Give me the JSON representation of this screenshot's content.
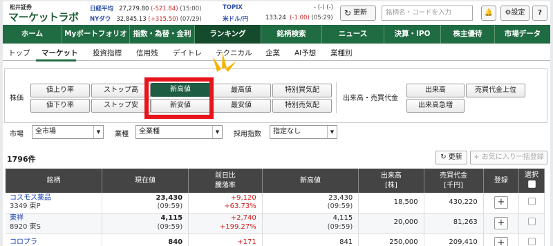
{
  "brand": {
    "small": "松井証券",
    "main": "マーケットラボ"
  },
  "tickers": [
    {
      "name": "日経平均",
      "value": "27,279.80",
      "change": "(-521.84)",
      "time": "(15:00)"
    },
    {
      "name": "NYダウ",
      "value": "32,845.13",
      "change": "(+315.50)",
      "time": "(07/29)"
    },
    {
      "name": "TOPIX",
      "value": "-",
      "change": "(-)",
      "time": "(-)"
    },
    {
      "name": "米ドル/円",
      "value": "133.24",
      "change": "(-1.00)",
      "time": "(05:29)"
    }
  ],
  "header": {
    "refresh": "更新",
    "search_placeholder": "銘柄名・コードを入力",
    "settings": "設定",
    "help": "?"
  },
  "main_nav": [
    "ホーム",
    "Myポートフォリオ",
    "指数・為替・金利",
    "ランキング",
    "銘柄検索",
    "ニュース",
    "決算・IPO",
    "株主優待",
    "市場データ"
  ],
  "sub_tabs": [
    "トップ",
    "マーケット",
    "投資指標",
    "信用残",
    "デイトレ",
    "テクニカル",
    "企業",
    "AI予想",
    "業種別"
  ],
  "filters": {
    "stock_label": "株価",
    "buttons_row1": [
      "値上り率",
      "ストップ高",
      "新高値",
      "最高値",
      "特別買気配"
    ],
    "buttons_row2": [
      "値下り率",
      "ストップ安",
      "新安値",
      "最安値",
      "特別売気配"
    ],
    "volume_label": "出来高・売買代金",
    "vol_row1": [
      "出来高",
      "売買代金上位"
    ],
    "vol_row2": [
      "出来高急増"
    ],
    "market_label": "市場",
    "market_value": "全市場",
    "sector_label": "業種",
    "sector_value": "全業種",
    "index_label": "採用指数",
    "index_value": "指定なし"
  },
  "result": {
    "count": "1796件",
    "refresh": "更新",
    "add_all": "お気に入り一括登録"
  },
  "table": {
    "headers": {
      "name": "銘柄",
      "price": "現在値",
      "change_top": "前日比",
      "change_bottom": "騰落率",
      "high": "新高値",
      "volume_top": "出来高",
      "volume_bottom": "[株]",
      "turnover_top": "売買代金",
      "turnover_bottom": "[千円]",
      "register": "登録",
      "select": "選択"
    },
    "rows": [
      {
        "name": "コスモス薬品",
        "code": "3349 東P",
        "price": "23,430",
        "time": "(09:59)",
        "change": "+9,120",
        "pct": "+63.73%",
        "high": "23,430",
        "high_time": "(09:59)",
        "volume": "18,500",
        "turnover": "430,220"
      },
      {
        "name": "東祥",
        "code": "8920 東S",
        "price": "4,115",
        "time": "(09:59)",
        "change": "+2,740",
        "pct": "+199.27%",
        "high": "4,115",
        "high_time": "(09:59)",
        "volume": "20,000",
        "turnover": "81,263"
      },
      {
        "name": "コロプラ",
        "code": "",
        "price": "840",
        "time": "",
        "change": "+171",
        "pct": "",
        "high": "841",
        "high_time": "",
        "volume": "250,000",
        "turnover": "209,410"
      }
    ]
  }
}
